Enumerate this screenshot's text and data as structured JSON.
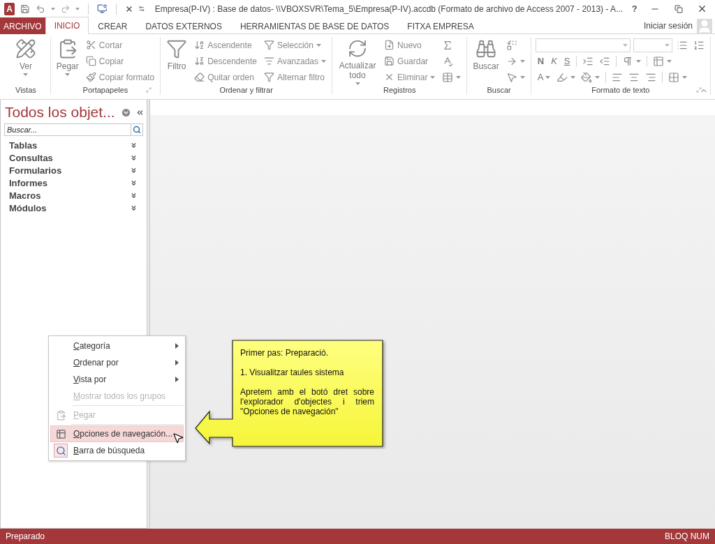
{
  "title_bar": {
    "app_logo": "A",
    "title": "Empresa(P-IV) : Base de datos- \\\\VBOXSVR\\Tema_5\\Empresa(P-IV).accdb (Formato de archivo de Access 2007 - 2013) - A...",
    "help": "?"
  },
  "tabs": [
    {
      "label": "ARCHIVO",
      "kind": "file",
      "selected": false
    },
    {
      "label": "INICIO",
      "kind": "tab",
      "selected": true
    },
    {
      "label": "CREAR",
      "kind": "tab",
      "selected": false
    },
    {
      "label": "DATOS EXTERNOS",
      "kind": "tab",
      "selected": false
    },
    {
      "label": "HERRAMIENTAS DE BASE DE DATOS",
      "kind": "tab",
      "selected": false
    },
    {
      "label": "FITXA EMPRESA",
      "kind": "tab",
      "selected": false
    }
  ],
  "account": {
    "label": "Iniciar sesión"
  },
  "ribbon": {
    "groups": [
      {
        "label": "Vistas",
        "launcher": false,
        "items": [
          {
            "kind": "large",
            "label": "Ver",
            "dropdown": true
          }
        ]
      },
      {
        "label": "Portapapeles",
        "launcher": true,
        "items": [
          {
            "kind": "large",
            "label": "Pegar",
            "dropdown": true
          },
          {
            "kind": "small",
            "label": "Cortar",
            "dropdown": false
          },
          {
            "kind": "small",
            "label": "Copiar",
            "dropdown": false
          },
          {
            "kind": "small",
            "label": "Copiar formato",
            "dropdown": false
          }
        ]
      },
      {
        "label": "Ordenar y filtrar",
        "launcher": false,
        "items": [
          {
            "kind": "large",
            "label": "Filtro",
            "dropdown": false
          },
          {
            "kind": "small",
            "label": "Ascendente",
            "dropdown": false
          },
          {
            "kind": "small",
            "label": "Descendente",
            "dropdown": false
          },
          {
            "kind": "small",
            "label": "Quitar orden",
            "dropdown": false
          },
          {
            "kind": "small",
            "label": "Selección",
            "dropdown": true
          },
          {
            "kind": "small",
            "label": "Avanzadas",
            "dropdown": true
          },
          {
            "kind": "small",
            "label": "Alternar filtro",
            "dropdown": false
          }
        ]
      },
      {
        "label": "Registros",
        "launcher": false,
        "items": [
          {
            "kind": "large",
            "label": "Actualizar todo",
            "dropdown": true
          },
          {
            "kind": "small",
            "label": "Nuevo",
            "dropdown": false
          },
          {
            "kind": "small",
            "label": "Guardar",
            "dropdown": false
          },
          {
            "kind": "small",
            "label": "Eliminar",
            "dropdown": true
          },
          {
            "kind": "icon",
            "dropdown": false
          },
          {
            "kind": "icon",
            "dropdown": false
          },
          {
            "kind": "icon",
            "dropdown": true
          }
        ]
      },
      {
        "label": "Buscar",
        "launcher": false,
        "items": [
          {
            "kind": "large",
            "label": "Buscar",
            "dropdown": false
          },
          {
            "kind": "icon",
            "dropdown": false
          },
          {
            "kind": "icon",
            "dropdown": true
          },
          {
            "kind": "icon",
            "dropdown": true
          }
        ]
      },
      {
        "label": "Formato de texto",
        "launcher": true,
        "rows": [
          [
            {
              "kind": "font-field"
            },
            {
              "kind": "size-field"
            },
            {
              "kind": "icon",
              "dropdown": false
            },
            {
              "kind": "icon",
              "dropdown": false
            }
          ],
          [
            {
              "kind": "bold-letter",
              "label": "N",
              "dropdown": false
            },
            {
              "kind": "italic-letter",
              "label": "K",
              "dropdown": false
            },
            {
              "kind": "underline-letter",
              "label": "S",
              "dropdown": false
            },
            {
              "kind": "separator"
            },
            {
              "kind": "icon",
              "dropdown": false
            },
            {
              "kind": "icon",
              "dropdown": false
            },
            {
              "kind": "separator"
            },
            {
              "kind": "icon",
              "dropdown": true
            },
            {
              "kind": "separator"
            },
            {
              "kind": "icon",
              "dropdown": true
            }
          ],
          [
            {
              "kind": "letter",
              "label": "A",
              "dropdown": true
            },
            {
              "kind": "icon",
              "dropdown": true
            },
            {
              "kind": "icon",
              "dropdown": true
            },
            {
              "kind": "separator"
            },
            {
              "kind": "icon",
              "dropdown": false
            },
            {
              "kind": "icon",
              "dropdown": false
            },
            {
              "kind": "icon",
              "dropdown": false
            },
            {
              "kind": "separator"
            },
            {
              "kind": "icon",
              "dropdown": true
            }
          ]
        ]
      }
    ]
  },
  "nav_pane": {
    "title": "Todos los objet...",
    "search": {
      "placeholder": "Buscar..."
    },
    "groups": [
      {
        "label": "Tablas"
      },
      {
        "label": "Consultas"
      },
      {
        "label": "Formularios"
      },
      {
        "label": "Informes"
      },
      {
        "label": "Macros"
      },
      {
        "label": "Módulos"
      }
    ]
  },
  "context_menu": [
    {
      "kind": "submenu",
      "label": "Categoría",
      "disabled": false,
      "selected": false
    },
    {
      "kind": "submenu",
      "label": "Ordenar por",
      "disabled": false,
      "selected": false
    },
    {
      "kind": "submenu",
      "label": "Vista por",
      "disabled": false,
      "selected": false
    },
    {
      "kind": "command",
      "label": "Mostrar todos los grupos",
      "disabled": true,
      "selected": false
    },
    {
      "kind": "separator"
    },
    {
      "kind": "icon-command",
      "label": "Pegar",
      "disabled": true,
      "selected": false,
      "checked": false
    },
    {
      "kind": "separator"
    },
    {
      "kind": "icon-command",
      "label": "Opciones de navegación...",
      "disabled": false,
      "selected": true,
      "checked": false
    },
    {
      "kind": "icon-command",
      "label": "Barra de búsqueda",
      "disabled": false,
      "selected": false,
      "checked": true
    }
  ],
  "callout": {
    "title": "Primer pas: Preparació.",
    "step": "1. Visualitzar taules sistema",
    "text": "Apretem amb el botó dret sobre l'explorador d'objectes i triem \"Opciones de navegación\""
  },
  "status_bar": {
    "left": "Preparado",
    "right": "BLOQ NUM"
  }
}
